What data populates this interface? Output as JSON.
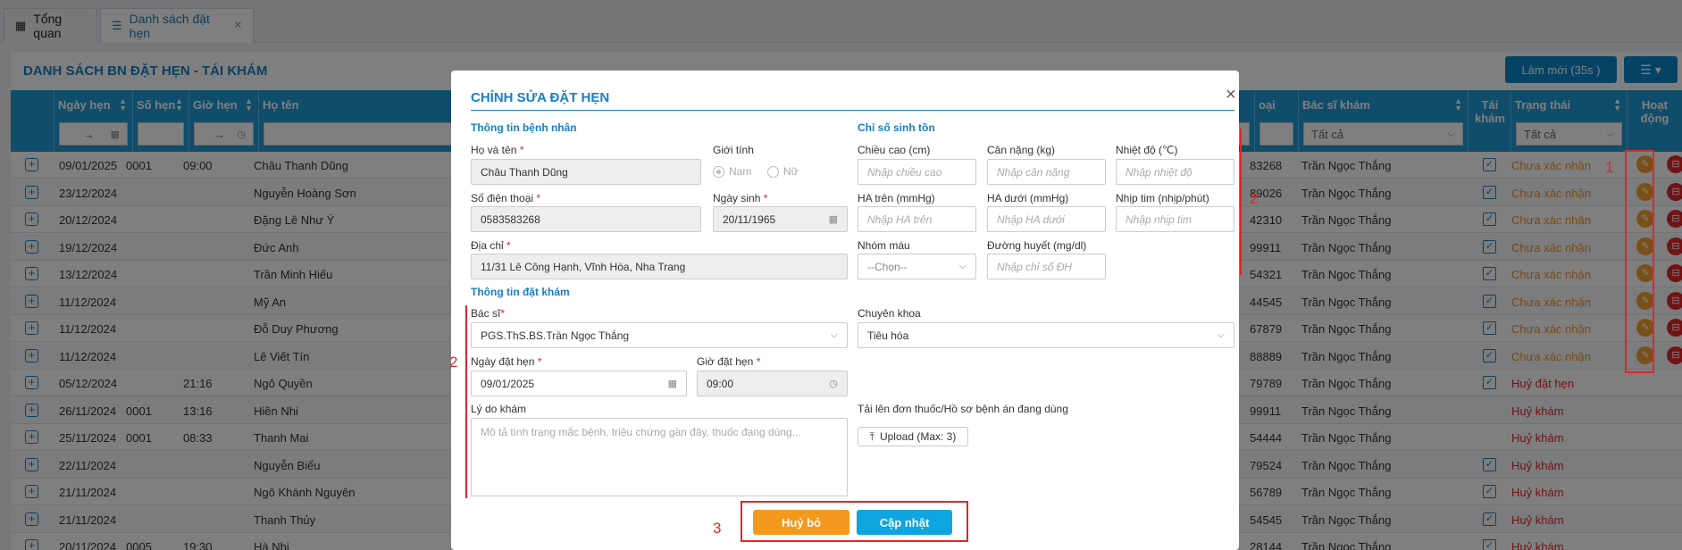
{
  "tabs": [
    {
      "label": "Tổng quan",
      "icon": "dashboard-icon"
    },
    {
      "label": "Danh sách đặt hẹn",
      "icon": "list-icon"
    }
  ],
  "page": {
    "title": "DANH SÁCH BN ĐẶT HẸN - TÁI KHÁM",
    "refresh_label": "Làm mới (35s )"
  },
  "table": {
    "columns": [
      "Ngày hẹn",
      "Số hẹn",
      "Giờ hẹn",
      "Họ tên",
      "oại",
      "Bác sĩ khám",
      "Tái khám",
      "Trạng thái",
      "Hoạt động"
    ],
    "filters": {
      "doctor": "Tất cả",
      "status": "Tất cả",
      "date_arrow": "→",
      "time_arrow": "→"
    },
    "rows": [
      {
        "date": "09/01/2025",
        "num": "0001",
        "time": "09:00",
        "name": "Châu Thanh Dũng",
        "phone": "83268",
        "doctor": "Trần Ngọc Thắng",
        "recheck": true,
        "status": "Chưa xác nhận",
        "status_type": "orange",
        "actions": true
      },
      {
        "date": "23/12/2024",
        "num": "",
        "time": "",
        "name": "Nguyễn Hoàng Sơn",
        "phone": "89026",
        "doctor": "Trần Ngọc Thắng",
        "recheck": true,
        "status": "Chưa xác nhận",
        "status_type": "orange",
        "actions": true
      },
      {
        "date": "20/12/2024",
        "num": "",
        "time": "",
        "name": "Đặng Lê Như Ý",
        "phone": "42310",
        "doctor": "Trần Ngọc Thắng",
        "recheck": true,
        "status": "Chưa xác nhận",
        "status_type": "orange",
        "actions": true
      },
      {
        "date": "19/12/2024",
        "num": "",
        "time": "",
        "name": "Đức Anh",
        "phone": "99911",
        "doctor": "Trần Ngọc Thắng",
        "recheck": true,
        "status": "Chưa xác nhận",
        "status_type": "orange",
        "actions": true
      },
      {
        "date": "13/12/2024",
        "num": "",
        "time": "",
        "name": "Trần Minh Hiếu",
        "phone": "54321",
        "doctor": "Trần Ngọc Thắng",
        "recheck": true,
        "status": "Chưa xác nhận",
        "status_type": "orange",
        "actions": true
      },
      {
        "date": "11/12/2024",
        "num": "",
        "time": "",
        "name": "Mỹ An",
        "phone": "44545",
        "doctor": "Trần Ngọc Thắng",
        "recheck": true,
        "status": "Chưa xác nhận",
        "status_type": "orange",
        "actions": true
      },
      {
        "date": "11/12/2024",
        "num": "",
        "time": "",
        "name": "Đỗ Duy Phương",
        "phone": "67879",
        "doctor": "Trần Ngọc Thắng",
        "recheck": true,
        "status": "Chưa xác nhận",
        "status_type": "orange",
        "actions": true
      },
      {
        "date": "11/12/2024",
        "num": "",
        "time": "",
        "name": "Lê Viết Tín",
        "phone": "88889",
        "doctor": "Trần Ngọc Thắng",
        "recheck": true,
        "status": "Chưa xác nhận",
        "status_type": "orange",
        "actions": true
      },
      {
        "date": "05/12/2024",
        "num": "",
        "time": "21:16",
        "name": "Ngô Quyền",
        "phone": "79789",
        "doctor": "Trần Ngọc Thắng",
        "recheck": true,
        "status": "Huỷ đặt hẹn",
        "status_type": "red",
        "actions": false
      },
      {
        "date": "26/11/2024",
        "num": "0001",
        "time": "13:16",
        "name": "Hiền Nhi",
        "phone": "99911",
        "doctor": "Trần Ngọc Thắng",
        "recheck": false,
        "status": "Huỷ khám",
        "status_type": "red",
        "actions": false
      },
      {
        "date": "25/11/2024",
        "num": "0001",
        "time": "08:33",
        "name": "Thanh Mai",
        "phone": "54444",
        "doctor": "Trần Ngọc Thắng",
        "recheck": false,
        "status": "Huỷ khám",
        "status_type": "red",
        "actions": false
      },
      {
        "date": "22/11/2024",
        "num": "",
        "time": "",
        "name": "Nguyễn Biểu",
        "phone": "79524",
        "doctor": "Trần Ngọc Thắng",
        "recheck": true,
        "status": "Huỷ khám",
        "status_type": "red",
        "actions": false
      },
      {
        "date": "21/11/2024",
        "num": "",
        "time": "",
        "name": "Ngô Khánh Nguyên",
        "phone": "56789",
        "doctor": "Trần Ngọc Thắng",
        "recheck": true,
        "status": "Huỷ khám",
        "status_type": "red",
        "actions": false
      },
      {
        "date": "21/11/2024",
        "num": "",
        "time": "",
        "name": "Thanh Thủy",
        "phone": "54545",
        "doctor": "Trần Ngọc Thắng",
        "recheck": true,
        "status": "Huỷ khám",
        "status_type": "red",
        "actions": false
      },
      {
        "date": "20/11/2024",
        "num": "0005",
        "time": "19:30",
        "name": "Hà Nhi",
        "phone": "28144",
        "doctor": "Trần Ngọc Thắng",
        "recheck": true,
        "status": "Huỷ khám",
        "status_type": "red",
        "actions": false
      }
    ]
  },
  "modal": {
    "title": "CHỈNH SỬA ĐẶT HẸN",
    "patient_section": "Thông tin bệnh nhân",
    "vitals_section": "Chỉ số sinh tồn",
    "booking_section": "Thông tin đặt khám",
    "fullname_label": "Họ và tên",
    "fullname_value": "Châu Thanh Dũng",
    "gender_label": "Giới tính",
    "gender_male": "Nam",
    "gender_female": "Nữ",
    "phone_label": "Số điện thoại",
    "phone_value": "0583583268",
    "dob_label": "Ngày sinh",
    "dob_value": "20/11/1965",
    "address_label": "Địa chỉ",
    "address_value": "11/31 Lê Công Hạnh, Vĩnh Hòa, Nha Trang",
    "height_label": "Chiều cao (cm)",
    "height_ph": "Nhập chiều cao",
    "weight_label": "Cân nặng (kg)",
    "weight_ph": "Nhập cân nặng",
    "temp_label": "Nhiệt độ (℃)",
    "temp_ph": "Nhập nhiệt độ",
    "sys_label": "HA trên (mmHg)",
    "sys_ph": "Nhập HA trên",
    "dia_label": "HA dưới (mmHg)",
    "dia_ph": "Nhập HA dưới",
    "hr_label": "Nhịp tim (nhịp/phút)",
    "hr_ph": "Nhập nhịp tim",
    "blood_label": "Nhóm máu",
    "blood_value": "--Chọn--",
    "glucose_label": "Đường huyết (mg/dl)",
    "glucose_ph": "Nhập chỉ số ĐH",
    "doctor_label": "Bác sĩ",
    "doctor_value": "PGS.ThS.BS.Trần Ngọc Thắng",
    "specialty_label": "Chuyên khoa",
    "specialty_value": "Tiêu hóa",
    "appt_date_label": "Ngày đặt hẹn",
    "appt_date_value": "09/01/2025",
    "appt_time_label": "Giờ đặt hẹn",
    "appt_time_value": "09:00",
    "reason_label": "Lý do khám",
    "reason_ph": "Mô tả tình trạng mắc bệnh, triệu chứng gần đây, thuốc đang dùng...",
    "upload_label": "Tải lên đơn thuốc/Hồ sơ bệnh án đang dùng",
    "upload_button": "Upload (Max: 3)",
    "cancel_button": "Huỷ bỏ",
    "update_button": "Cập nhật",
    "required_mark": "*"
  },
  "annotations": {
    "n1": "1",
    "n2a": "2",
    "n2b": "2",
    "n3": "3"
  },
  "colors": {
    "primary": "#1e9bd7",
    "accent": "#1a7fc1",
    "orange": "#f0932b",
    "red": "#e0272b"
  }
}
